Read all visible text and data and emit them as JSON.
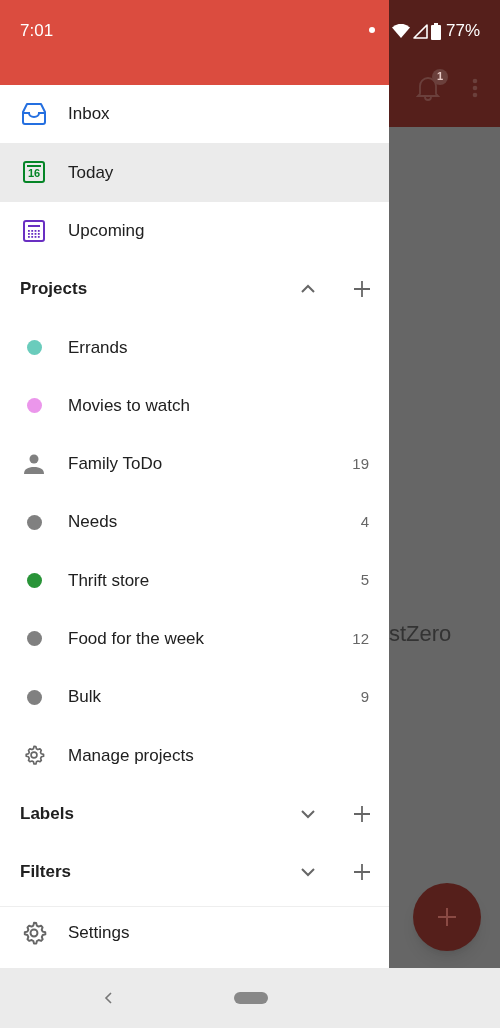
{
  "status_bar": {
    "time": "7:01",
    "battery": "77%"
  },
  "app_bar": {
    "notification_count": "1"
  },
  "background_text": "stZero",
  "drawer": {
    "views": [
      {
        "label": "Inbox",
        "kind": "inbox",
        "selected": false
      },
      {
        "label": "Today",
        "kind": "today",
        "date": "16",
        "selected": true
      },
      {
        "label": "Upcoming",
        "kind": "upcoming",
        "selected": false
      }
    ],
    "sections": [
      {
        "title": "Projects",
        "expanded": true,
        "items": [
          {
            "name": "Errands",
            "kind": "dot",
            "color": "#6accbc"
          },
          {
            "name": "Movies to watch",
            "kind": "dot",
            "color": "#eb96eb"
          },
          {
            "name": "Family ToDo",
            "kind": "shared",
            "count": "19"
          },
          {
            "name": "Needs",
            "kind": "dot",
            "color": "#808080",
            "count": "4"
          },
          {
            "name": "Thrift store",
            "kind": "dot",
            "color": "#299438",
            "count": "5"
          },
          {
            "name": "Food for the week",
            "kind": "dot",
            "color": "#808080",
            "count": "12"
          },
          {
            "name": "Bulk",
            "kind": "dot",
            "color": "#808080",
            "count": "9"
          }
        ],
        "manage": "Manage projects"
      },
      {
        "title": "Labels",
        "expanded": false
      },
      {
        "title": "Filters",
        "expanded": false
      }
    ],
    "settings": "Settings"
  }
}
